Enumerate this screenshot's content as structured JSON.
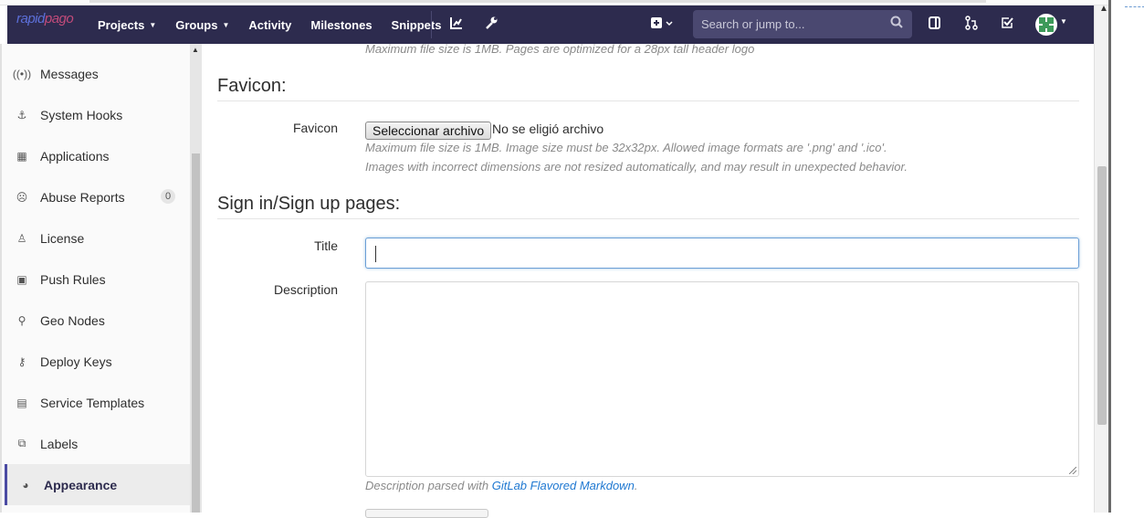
{
  "navbar": {
    "logo_text_a": "rapid",
    "logo_text_b": "pago",
    "links": [
      {
        "label": "Projects",
        "caret": true
      },
      {
        "label": "Groups",
        "caret": true
      },
      {
        "label": "Activity",
        "caret": false
      },
      {
        "label": "Milestones",
        "caret": false
      },
      {
        "label": "Snippets",
        "caret": false
      }
    ],
    "search_placeholder": "Search or jump to..."
  },
  "sidebar": {
    "items": [
      {
        "label": "Messages",
        "icon": "broadcast-icon"
      },
      {
        "label": "System Hooks",
        "icon": "hook-icon"
      },
      {
        "label": "Applications",
        "icon": "grid-icon"
      },
      {
        "label": "Abuse Reports",
        "icon": "flag-icon",
        "badge": "0"
      },
      {
        "label": "License",
        "icon": "certificate-icon"
      },
      {
        "label": "Push Rules",
        "icon": "push-rules-icon"
      },
      {
        "label": "Geo Nodes",
        "icon": "map-pin-icon"
      },
      {
        "label": "Deploy Keys",
        "icon": "key-icon"
      },
      {
        "label": "Service Templates",
        "icon": "template-icon"
      },
      {
        "label": "Labels",
        "icon": "labels-icon"
      },
      {
        "label": "Appearance",
        "icon": "palette-icon",
        "active": true
      }
    ]
  },
  "content": {
    "header_logo_hint": "Maximum file size is 1MB. Pages are optimized for a 28px tall header logo",
    "favicon_section_title": "Favicon:",
    "favicon_label": "Favicon",
    "file_button_label": "Seleccionar archivo",
    "file_status": "No se eligió archivo",
    "favicon_hint_1": "Maximum file size is 1MB. Image size must be 32x32px. Allowed image formats are '.png' and '.ico'.",
    "favicon_hint_2": "Images with incorrect dimensions are not resized automatically, and may result in unexpected behavior.",
    "signin_section_title": "Sign in/Sign up pages:",
    "title_label": "Title",
    "title_value": "",
    "description_label": "Description",
    "description_value": "",
    "desc_hint_prefix": "Description parsed with ",
    "desc_hint_link": "GitLab Flavored Markdown",
    "desc_hint_suffix": "."
  },
  "colors": {
    "navbar_bg": "#2d2b4e",
    "active_accent": "#4b4ba3",
    "link": "#1f78d1"
  }
}
